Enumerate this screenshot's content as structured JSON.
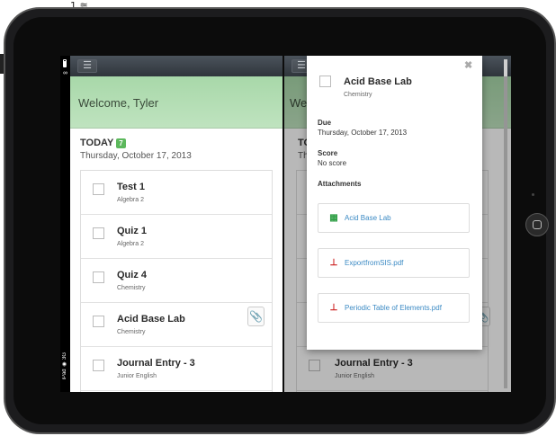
{
  "device": {
    "top_mark": "1 ≋"
  },
  "status_bar": {
    "text": "iPad ◉ 3G"
  },
  "left_pane": {
    "welcome": "Welcome, Tyler",
    "today_label": "TODAY",
    "today_count": "7",
    "date": "Thursday, October 17, 2013",
    "tasks": [
      {
        "title": "Test 1",
        "subject": "Algebra 2"
      },
      {
        "title": "Quiz 1",
        "subject": "Algebra 2"
      },
      {
        "title": "Quiz 4",
        "subject": "Chemistry"
      },
      {
        "title": "Acid Base Lab",
        "subject": "Chemistry"
      },
      {
        "title": "Journal Entry - 3",
        "subject": "Junior English"
      }
    ]
  },
  "right_pane": {
    "welcome_partial": "We",
    "today_partial": "TO",
    "date_partial": "Th",
    "visible_task": {
      "title": "Journal Entry - 3",
      "subject": "Junior English"
    }
  },
  "popover": {
    "title": "Acid Base Lab",
    "subject": "Chemistry",
    "due_label": "Due",
    "due_value": "Thursday, October 17, 2013",
    "score_label": "Score",
    "score_value": "No score",
    "attachments_label": "Attachments",
    "attachments": [
      {
        "name": "Acid Base Lab",
        "icon": "spreadsheet-icon"
      },
      {
        "name": "ExportfromSIS.pdf",
        "icon": "pdf-icon"
      },
      {
        "name": "Periodic Table of Elements.pdf",
        "icon": "pdf-icon"
      }
    ]
  },
  "colors": {
    "topbar": "#3a4047",
    "welcome_bg": "#b4ddb4",
    "badge": "#5cb85c",
    "link": "#3b8ac4",
    "pdf": "#cc2020",
    "sheet": "#2e9e44"
  }
}
